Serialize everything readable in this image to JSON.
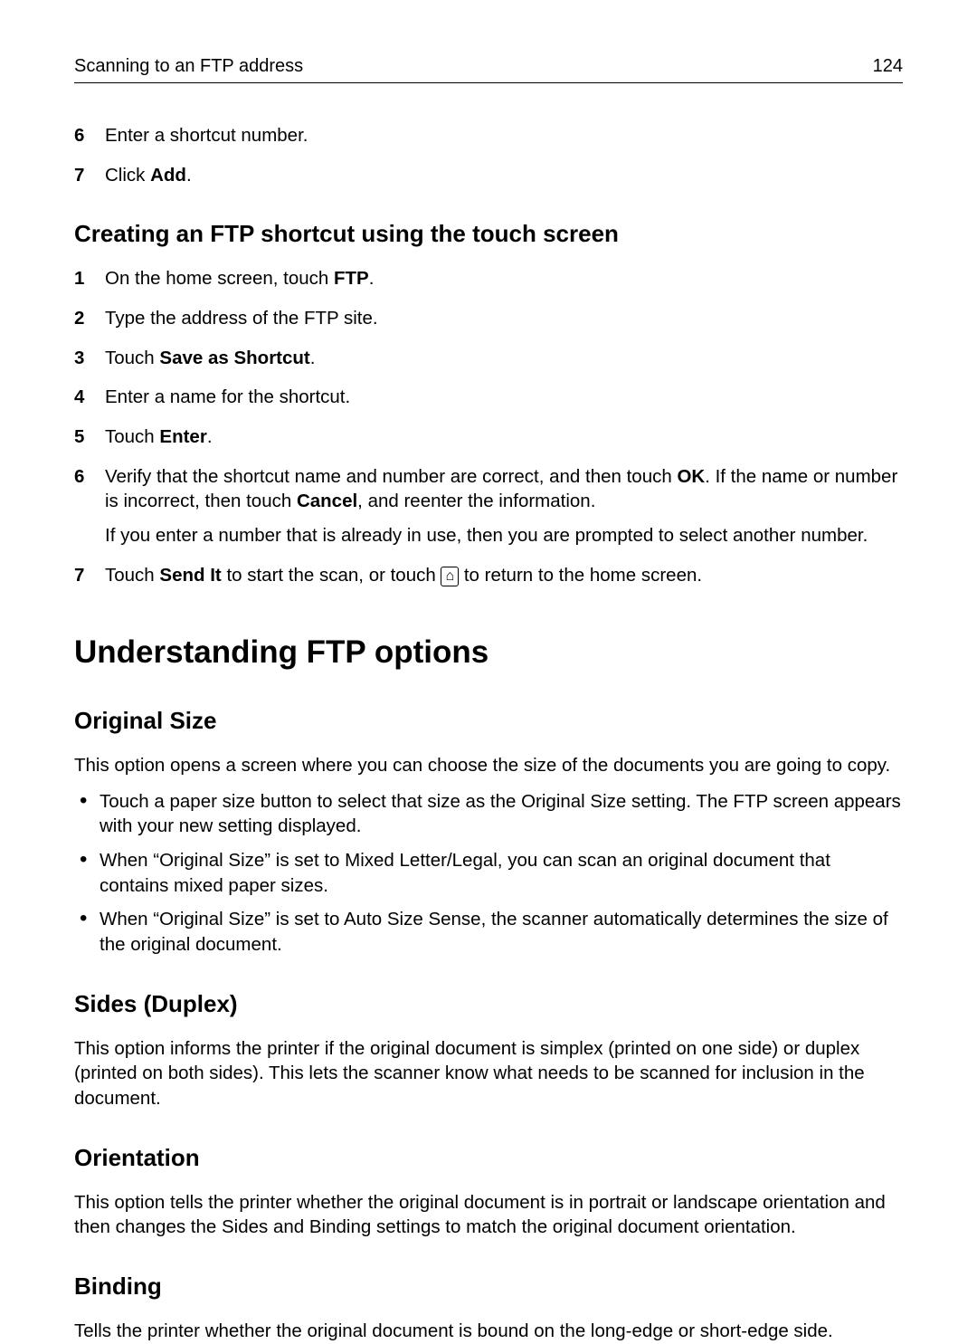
{
  "header": {
    "title": "Scanning to an FTP address",
    "page": "124"
  },
  "top_list": {
    "step6": {
      "pre": "Enter a shortcut number."
    },
    "step7": {
      "pre": "Click ",
      "bold": "Add",
      "post": "."
    }
  },
  "section_a": {
    "title": "Creating an FTP shortcut using the touch screen",
    "s1": {
      "pre": "On the home screen, touch ",
      "bold": "FTP",
      "post": "."
    },
    "s2": {
      "pre": "Type the address of the FTP site."
    },
    "s3": {
      "pre": "Touch ",
      "bold": "Save as Shortcut",
      "post": "."
    },
    "s4": {
      "pre": "Enter a name for the shortcut."
    },
    "s5": {
      "pre": "Touch ",
      "bold": "Enter",
      "post": "."
    },
    "s6": {
      "pre": "Verify that the shortcut name and number are correct, and then touch ",
      "bold1": "OK",
      "mid": ". If the name or number is incorrect, then touch ",
      "bold2": "Cancel",
      "post": ", and reenter the information.",
      "note": "If you enter a number that is already in use, then you are prompted to select another number."
    },
    "s7": {
      "pre": "Touch ",
      "bold": "Send It",
      "mid": " to start the scan, or touch ",
      "icon_name": "⌂",
      "post": " to return to the home screen."
    }
  },
  "section_b": {
    "title": "Understanding FTP options",
    "orig_size": {
      "title": "Original Size",
      "intro": "This option opens a screen where you can choose the size of the documents you are going to copy.",
      "b1": "Touch a paper size button to select that size as the Original Size setting. The FTP screen appears with your new setting displayed.",
      "b2": "When “Original Size” is set to Mixed Letter/Legal, you can scan an original document that contains mixed paper sizes.",
      "b3": "When “Original Size” is set to Auto Size Sense, the scanner automatically determines the size of the original document."
    },
    "sides": {
      "title": "Sides (Duplex)",
      "body": "This option informs the printer if the original document is simplex (printed on one side) or duplex (printed on both sides). This lets the scanner know what needs to be scanned for inclusion in the document."
    },
    "orientation": {
      "title": "Orientation",
      "body": "This option tells the printer whether the original document is in portrait or landscape orientation and then changes the Sides and Binding settings to match the original document orientation."
    },
    "binding": {
      "title": "Binding",
      "body": "Tells the printer whether the original document is bound on the long-edge or short-edge side."
    }
  }
}
